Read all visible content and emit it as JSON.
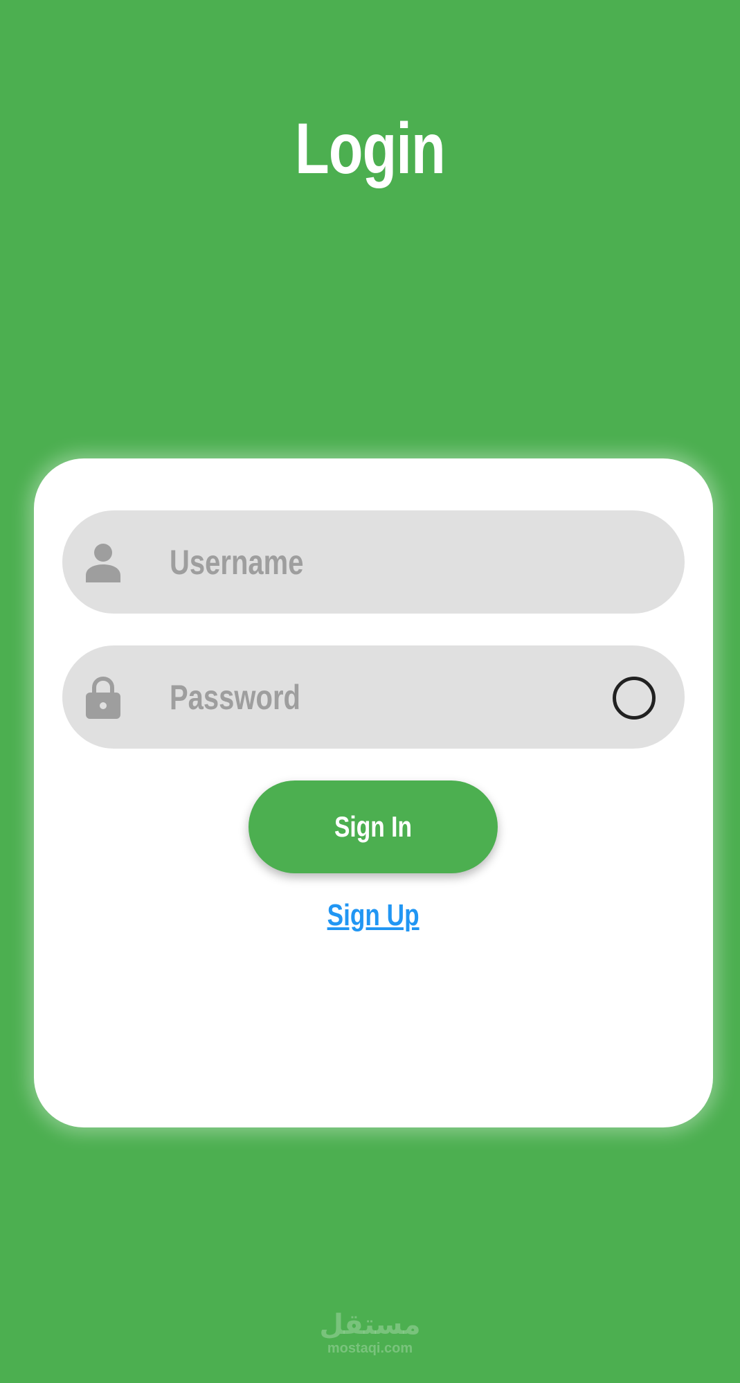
{
  "header": {
    "title": "Login"
  },
  "form": {
    "username": {
      "placeholder": "Username",
      "value": "",
      "icon": "person-icon"
    },
    "password": {
      "placeholder": "Password",
      "value": "",
      "icon": "lock-icon",
      "toggle_icon": "visibility-toggle-icon"
    },
    "sign_in_label": "Sign In",
    "sign_up_label": "Sign Up"
  },
  "watermark": {
    "arabic": "مستقل",
    "latin": "mostaqi.com"
  },
  "colors": {
    "background": "#4caf50",
    "card": "#ffffff",
    "field": "#e0e0e0",
    "placeholder": "#9e9e9e",
    "button": "#4caf50",
    "link": "#2196f3"
  }
}
